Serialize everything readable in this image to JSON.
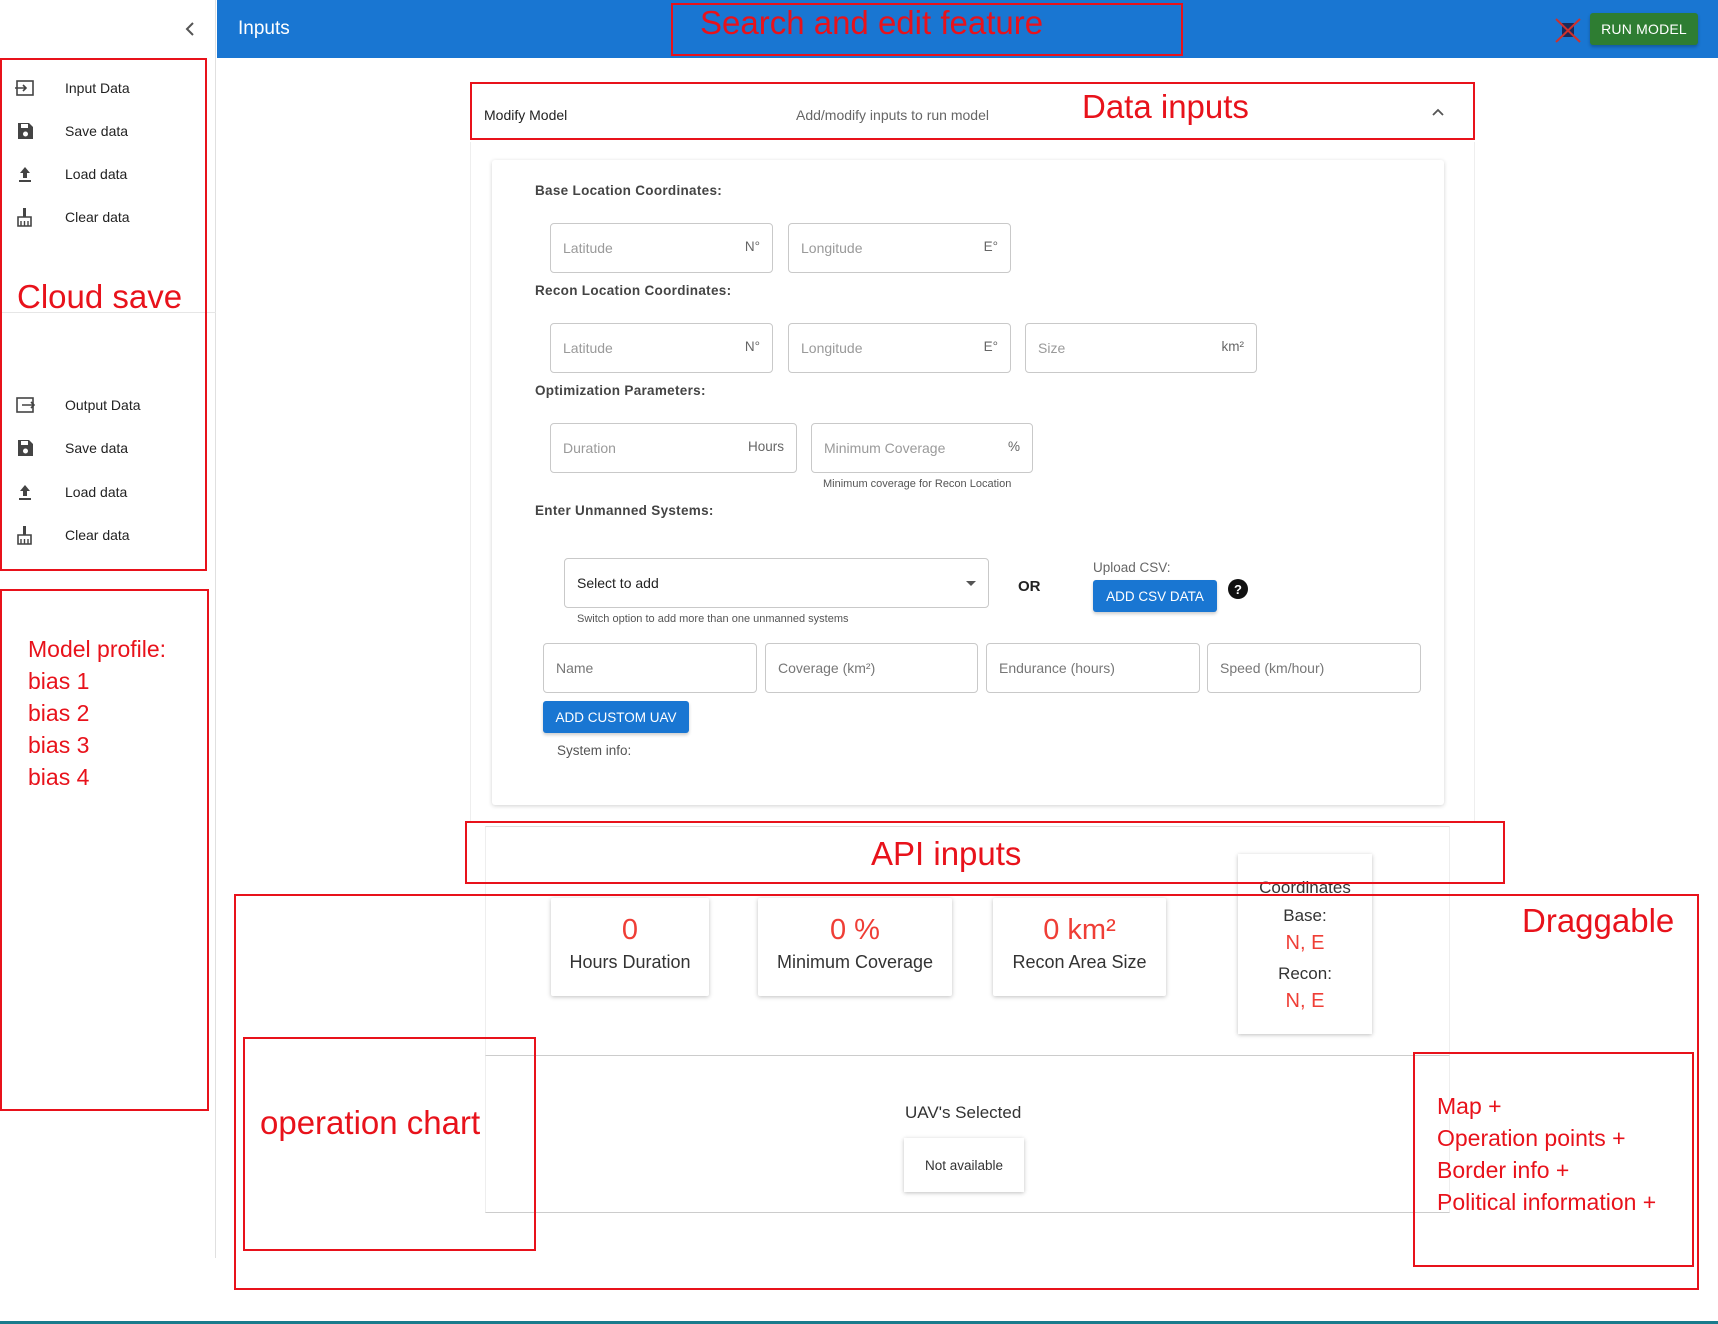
{
  "header": {
    "title": "Inputs",
    "run_label": "RUN MODEL"
  },
  "sidebar": {
    "group1": [
      {
        "label": "Input Data",
        "icon": "input-icon"
      },
      {
        "label": "Save data",
        "icon": "save-icon"
      },
      {
        "label": "Load data",
        "icon": "upload-icon"
      },
      {
        "label": "Clear data",
        "icon": "broom-icon"
      }
    ],
    "group2": [
      {
        "label": "Output Data",
        "icon": "output-icon"
      },
      {
        "label": "Save data",
        "icon": "save-icon"
      },
      {
        "label": "Load data",
        "icon": "upload-icon"
      },
      {
        "label": "Clear data",
        "icon": "broom-icon"
      }
    ]
  },
  "accordion": {
    "title": "Modify Model",
    "subtitle": "Add/modify inputs to run model"
  },
  "form": {
    "base_label": "Base Location Coordinates:",
    "recon_label": "Recon Location Coordinates:",
    "opt_label": "Optimization Parameters:",
    "unmanned_label": "Enter Unmanned Systems:",
    "base_lat": {
      "placeholder": "Latitude",
      "unit": "N°"
    },
    "base_lon": {
      "placeholder": "Longitude",
      "unit": "E°"
    },
    "recon_lat": {
      "placeholder": "Latitude",
      "unit": "N°"
    },
    "recon_lon": {
      "placeholder": "Longitude",
      "unit": "E°"
    },
    "recon_size": {
      "placeholder": "Size",
      "unit": "km²"
    },
    "duration": {
      "placeholder": "Duration",
      "unit": "Hours"
    },
    "min_cov": {
      "placeholder": "Minimum Coverage",
      "unit": "%"
    },
    "min_cov_helper": "Minimum coverage for Recon Location",
    "select_value": "Select to add",
    "select_helper": "Switch option to add more than one unmanned systems",
    "or": "OR",
    "upload_label": "Upload CSV:",
    "add_csv": "ADD CSV DATA",
    "help": "?",
    "uav_name": "Name",
    "uav_coverage": "Coverage (km²)",
    "uav_endurance": "Endurance (hours)",
    "uav_speed": "Speed (km/hour)",
    "add_custom": "ADD CUSTOM UAV",
    "system_info": "System info:"
  },
  "stats": [
    {
      "value": "0",
      "caption": "Hours Duration"
    },
    {
      "value": "0 %",
      "caption": "Minimum Coverage"
    },
    {
      "value": "0 km²",
      "caption": "Recon Area Size"
    }
  ],
  "coords": {
    "title": "Coordinates",
    "base_label": "Base:",
    "base_value": "N, E",
    "recon_label": "Recon:",
    "recon_value": "N, E"
  },
  "uav": {
    "title": "UAV's Selected",
    "status": "Not available"
  },
  "annotations": {
    "search": "Search and edit feature",
    "data_inputs": "Data inputs",
    "cloud_save": "Cloud save",
    "model_profile": [
      "Model profile:",
      "bias 1",
      "bias 2",
      "bias 3",
      "bias 4"
    ],
    "api_inputs": "API inputs",
    "draggable": "Draggable",
    "operation_chart": "operation chart",
    "map": [
      "Map +",
      "Operation points +",
      "Border info +",
      "Political information +"
    ]
  },
  "colors": {
    "primary": "#1976d2",
    "run": "#2e7d32",
    "stat_value": "#ef3e36",
    "annotation": "#e8121b"
  }
}
